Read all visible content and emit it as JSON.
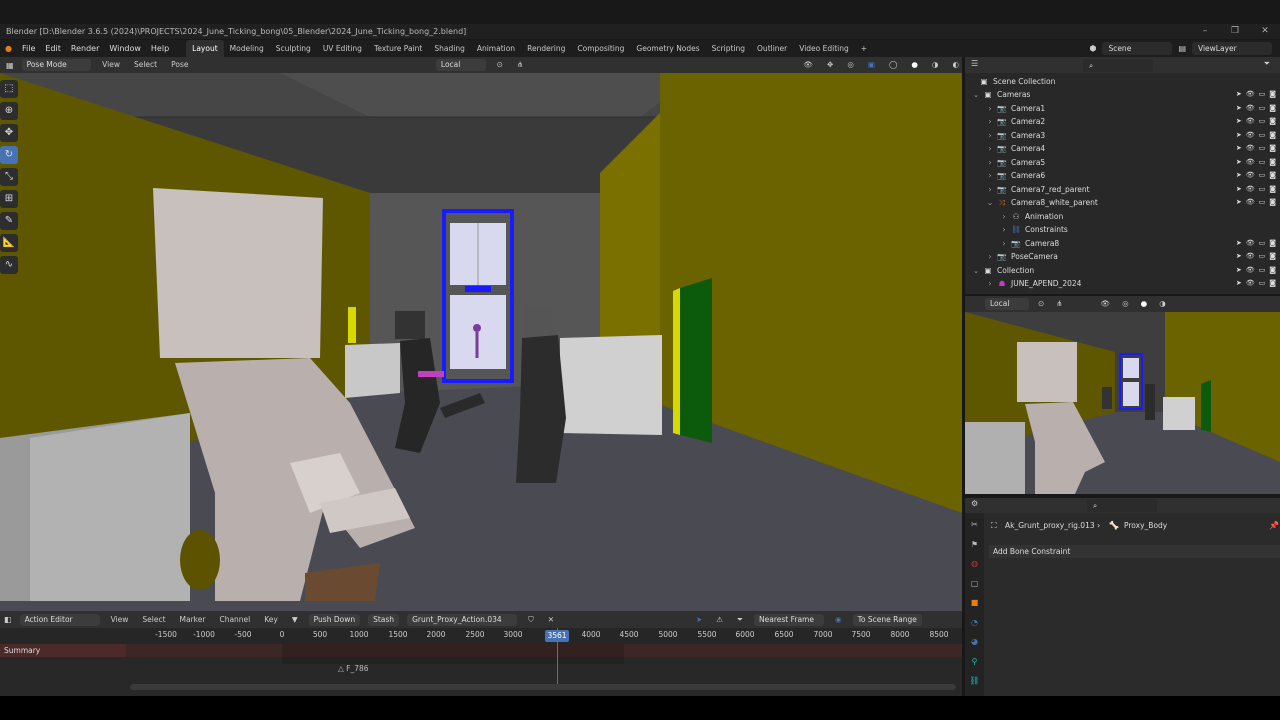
{
  "window": {
    "title": "Blender [D:\\Blender 3.6.5 (2024)\\PROJECTS\\2024_June_Ticking_bong\\05_Blender\\2024_June_Ticking_bong_2.blend]"
  },
  "menu": [
    "File",
    "Edit",
    "Render",
    "Window",
    "Help"
  ],
  "workspaces": [
    "Layout",
    "Modeling",
    "Sculpting",
    "UV Editing",
    "Texture Paint",
    "Shading",
    "Animation",
    "Rendering",
    "Compositing",
    "Geometry Nodes",
    "Scripting",
    "Outliner",
    "Video Editing"
  ],
  "scene": {
    "name": "Scene",
    "view_layer": "ViewLayer"
  },
  "viewport": {
    "mode": "Pose Mode",
    "menus": [
      "View",
      "Select",
      "Pose"
    ],
    "orientation": "Local"
  },
  "timeline": {
    "editor": "Action Editor",
    "menus": [
      "View",
      "Select",
      "Marker",
      "Channel",
      "Key"
    ],
    "push_down": "Push Down",
    "stash": "Stash",
    "action": "Grunt_Proxy_Action.034",
    "snapping": "Nearest Frame",
    "to_scene_range": "To Scene Range",
    "current_frame": "3561",
    "ticks": [
      "-1500",
      "-1000",
      "-500",
      "0",
      "500",
      "1000",
      "1500",
      "2000",
      "2500",
      "3000",
      "4000",
      "4500",
      "5000",
      "5500",
      "6000",
      "6500",
      "7000",
      "7500",
      "8000",
      "8500"
    ],
    "summary": "Summary",
    "marker": "F_786"
  },
  "outliner": {
    "scene_collection": "Scene Collection",
    "rows": [
      {
        "label": "Cameras",
        "indent": 1,
        "type": "collection"
      },
      {
        "label": "Camera1",
        "indent": 2,
        "type": "object"
      },
      {
        "label": "Camera2",
        "indent": 2,
        "type": "object"
      },
      {
        "label": "Camera3",
        "indent": 2,
        "type": "object"
      },
      {
        "label": "Camera4",
        "indent": 2,
        "type": "object"
      },
      {
        "label": "Camera5",
        "indent": 2,
        "type": "object"
      },
      {
        "label": "Camera6",
        "indent": 2,
        "type": "object"
      },
      {
        "label": "Camera7_red_parent",
        "indent": 2,
        "type": "object"
      },
      {
        "label": "Camera8_white_parent",
        "indent": 2,
        "type": "empty"
      },
      {
        "label": "Animation",
        "indent": 3,
        "type": "anim"
      },
      {
        "label": "Constraints",
        "indent": 3,
        "type": "constraint"
      },
      {
        "label": "Camera8",
        "indent": 3,
        "type": "object"
      },
      {
        "label": "PoseCamera",
        "indent": 2,
        "type": "object"
      },
      {
        "label": "Collection",
        "indent": 1,
        "type": "collection"
      },
      {
        "label": "JUNE_APEND_2024",
        "indent": 2,
        "type": "armature"
      }
    ]
  },
  "preview": {
    "orientation": "Local"
  },
  "properties": {
    "object": "Ak_Grunt_proxy_rig.013",
    "bone": "Proxy_Body",
    "add_constraint": "Add Bone Constraint"
  },
  "colors": {
    "accent": "#4772b3",
    "wall": "#6b6200",
    "floor": "#4a4a52",
    "summary": "#4d2a2a"
  }
}
